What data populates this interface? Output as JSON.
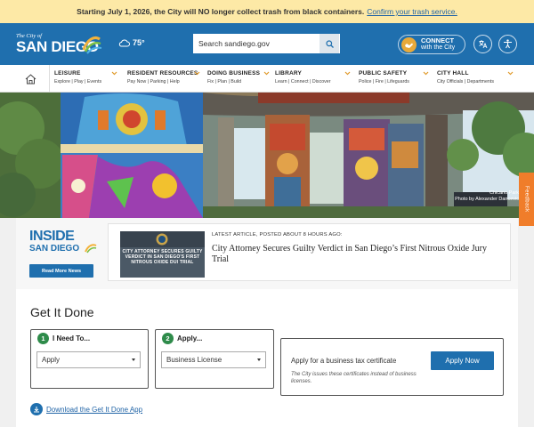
{
  "alert": {
    "message": "Starting July 1, 2026, the City will NO longer collect trash from black containers.",
    "link": "Confirm your trash service."
  },
  "header": {
    "logo_small": "The City of",
    "logo_big": "SAN DIEGO",
    "weather": "75°",
    "search_placeholder": "Search sandiego.gov",
    "connect_line1": "CONNECT",
    "connect_line2": "with the City"
  },
  "nav": {
    "items": [
      {
        "label": "LEISURE",
        "sub": "Explore | Play | Events"
      },
      {
        "label": "RESIDENT RESOURCES",
        "sub": "Pay Now | Parking | Help"
      },
      {
        "label": "DOING BUSINESS",
        "sub": "Fix | Plan | Build"
      },
      {
        "label": "LIBRARY",
        "sub": "Learn | Connect | Discover"
      },
      {
        "label": "PUBLIC SAFETY",
        "sub": "Police | Fire | Lifeguards"
      },
      {
        "label": "CITY HALL",
        "sub": "City Officials | Departments"
      }
    ]
  },
  "hero": {
    "caption_line1": "Chicano Park",
    "caption_line2": "Photo by Alexander Dancevic"
  },
  "feedback": "Feedback",
  "inside": {
    "logo_line1": "INSIDE",
    "logo_line2": "SAN DIEGO",
    "read_more": "Read More News",
    "article_meta": "LATEST ARTICLE, POSTED ABOUT 8 HOURS AGO:",
    "article_title": "City Attorney Secures Guilty Verdict in San Diego’s First Nitrous Oxide Jury Trial",
    "thumb_text": "CITY ATTORNEY SECURES GUILTY VERDICT IN SAN DIEGO'S FIRST NITROUS OXIDE DUI TRIAL"
  },
  "get_it_done": {
    "title": "Get It Done",
    "step1_num": "1",
    "step1_label": "I Need To...",
    "step1_value": "Apply",
    "step2_num": "2",
    "step2_label": "Apply...",
    "step2_value": "Business License",
    "result_title": "Apply for a business tax certificate",
    "result_note": "The City issues these certificates instead of business licenses.",
    "apply_button": "Apply Now",
    "download_link": "Download the Get It Done App"
  },
  "colors": {
    "primary_blue": "#1f6fae",
    "alert_yellow": "#fde9a6",
    "accent_orange": "#f07d2a",
    "step_green": "#2e8b4a"
  }
}
